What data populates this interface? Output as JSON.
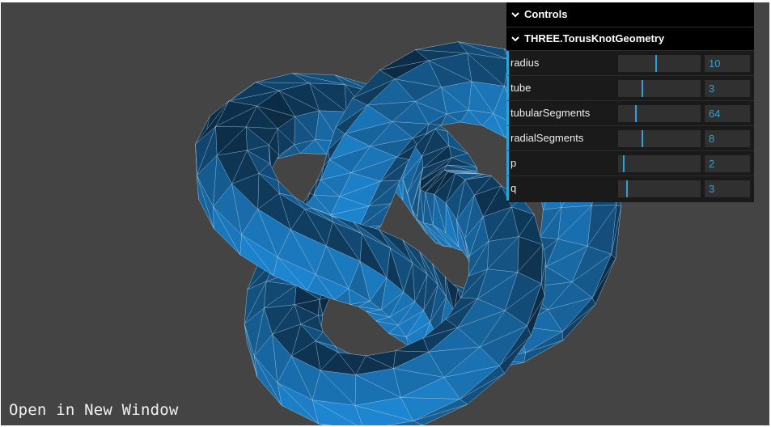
{
  "scene": {
    "background": "#444444",
    "object": "torus-knot",
    "mesh_color": "#2a7db3",
    "wire_color": "#c9e4f3"
  },
  "link": {
    "label": "Open in New Window"
  },
  "gui": {
    "title": "Controls",
    "folder": "THREE.TorusKnotGeometry",
    "accent": "#2fa1d6",
    "controls": [
      {
        "key": "radius",
        "label": "radius",
        "value": "10",
        "fraction": 0.46
      },
      {
        "key": "tube",
        "label": "tube",
        "value": "3",
        "fraction": 0.29
      },
      {
        "key": "tubularSegments",
        "label": "tubularSegments",
        "value": "64",
        "fraction": 0.21
      },
      {
        "key": "radialSegments",
        "label": "radialSegments",
        "value": "8",
        "fraction": 0.29
      },
      {
        "key": "p",
        "label": "p",
        "value": "2",
        "fraction": 0.06
      },
      {
        "key": "q",
        "label": "q",
        "value": "3",
        "fraction": 0.1
      }
    ]
  }
}
